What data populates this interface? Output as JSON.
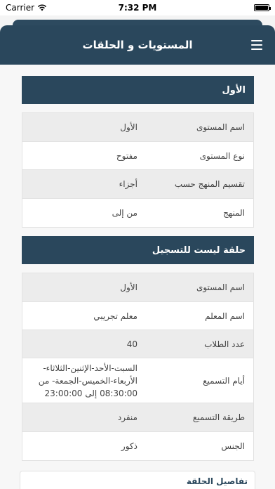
{
  "status_bar": {
    "carrier": "Carrier",
    "time": "7:32 PM",
    "battery_level": 1.0
  },
  "header": {
    "title": "المستويات و الحلقات"
  },
  "level_section": {
    "title": "الأول",
    "rows": [
      {
        "label": "اسم المستوى",
        "value": "الأول"
      },
      {
        "label": "نوع المستوى",
        "value": "مفتوح"
      },
      {
        "label": "تقسيم المنهج حسب",
        "value": "أجزاء"
      },
      {
        "label": "المنهج",
        "value": "من  إلى"
      }
    ]
  },
  "circle_section": {
    "title": "حلقة ليست للتسجيل",
    "rows": [
      {
        "label": "اسم المستوى",
        "value": "الأول"
      },
      {
        "label": "اسم المعلم",
        "value": "معلم تجريبي"
      },
      {
        "label": "عدد الطلاب",
        "value": "40"
      },
      {
        "label": "أيام التسميع",
        "value": "السبت-الأحد-الإثنين-الثلاثاء-الأربعاء-الخميس-الجمعة- من 08:30:00 إلى 23:00:00"
      },
      {
        "label": "طريقة التسميع",
        "value": "منفرد"
      },
      {
        "label": "الجنس",
        "value": "ذكور"
      }
    ]
  },
  "details": {
    "title": "تفاصيل الحلقة"
  }
}
